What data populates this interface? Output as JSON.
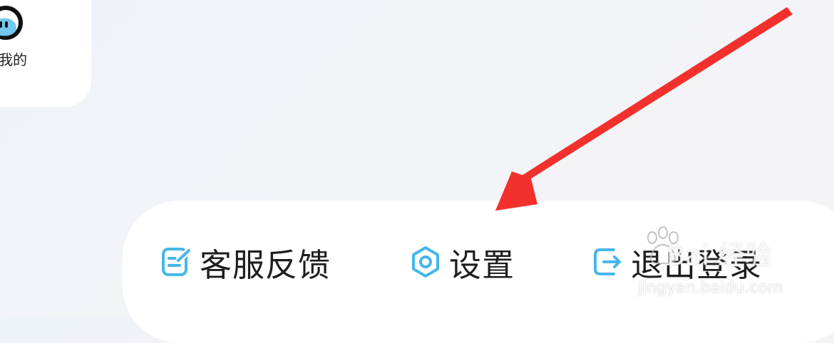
{
  "profile_card": {
    "nav_label": "我的",
    "avatar_icon": "blue-character-avatar"
  },
  "bottom_menu": {
    "items": [
      {
        "label": "客服反馈",
        "icon": "feedback-icon"
      },
      {
        "label": "设置",
        "icon": "settings-icon"
      },
      {
        "label": "退出登录",
        "icon": "logout-icon"
      }
    ]
  },
  "annotation": {
    "arrow_color": "#f2312c",
    "points_to": "settings"
  },
  "watermark": {
    "brand": "Bai 经验",
    "url": "jingyan.baidu.com"
  },
  "colors": {
    "icon_accent": "#47b6ea",
    "text": "#1e1e1e"
  }
}
